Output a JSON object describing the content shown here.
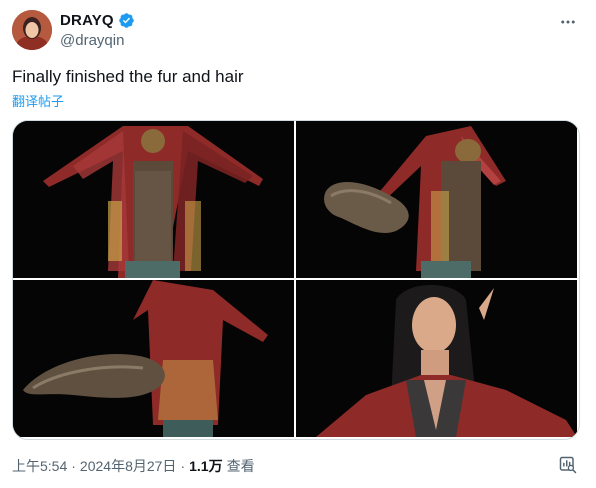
{
  "author": {
    "display_name": "DRAYQ",
    "handle": "@drayqin",
    "verified": true
  },
  "tweet": {
    "text": "Finally finished the fur and hair",
    "translate_label": "翻译帖子"
  },
  "media": {
    "images": [
      {
        "icon": "character-front-render"
      },
      {
        "icon": "character-side-tail-render"
      },
      {
        "icon": "character-back-tail-render"
      },
      {
        "icon": "character-portrait-render"
      }
    ]
  },
  "footer": {
    "time": "上午5:54",
    "separator": "·",
    "date": "2024年8月27日",
    "views_count": "1.1万",
    "views_label": "查看"
  },
  "colors": {
    "link": "#1d9bf0",
    "secondary_text": "#536471",
    "verified": "#1d9bf0"
  }
}
